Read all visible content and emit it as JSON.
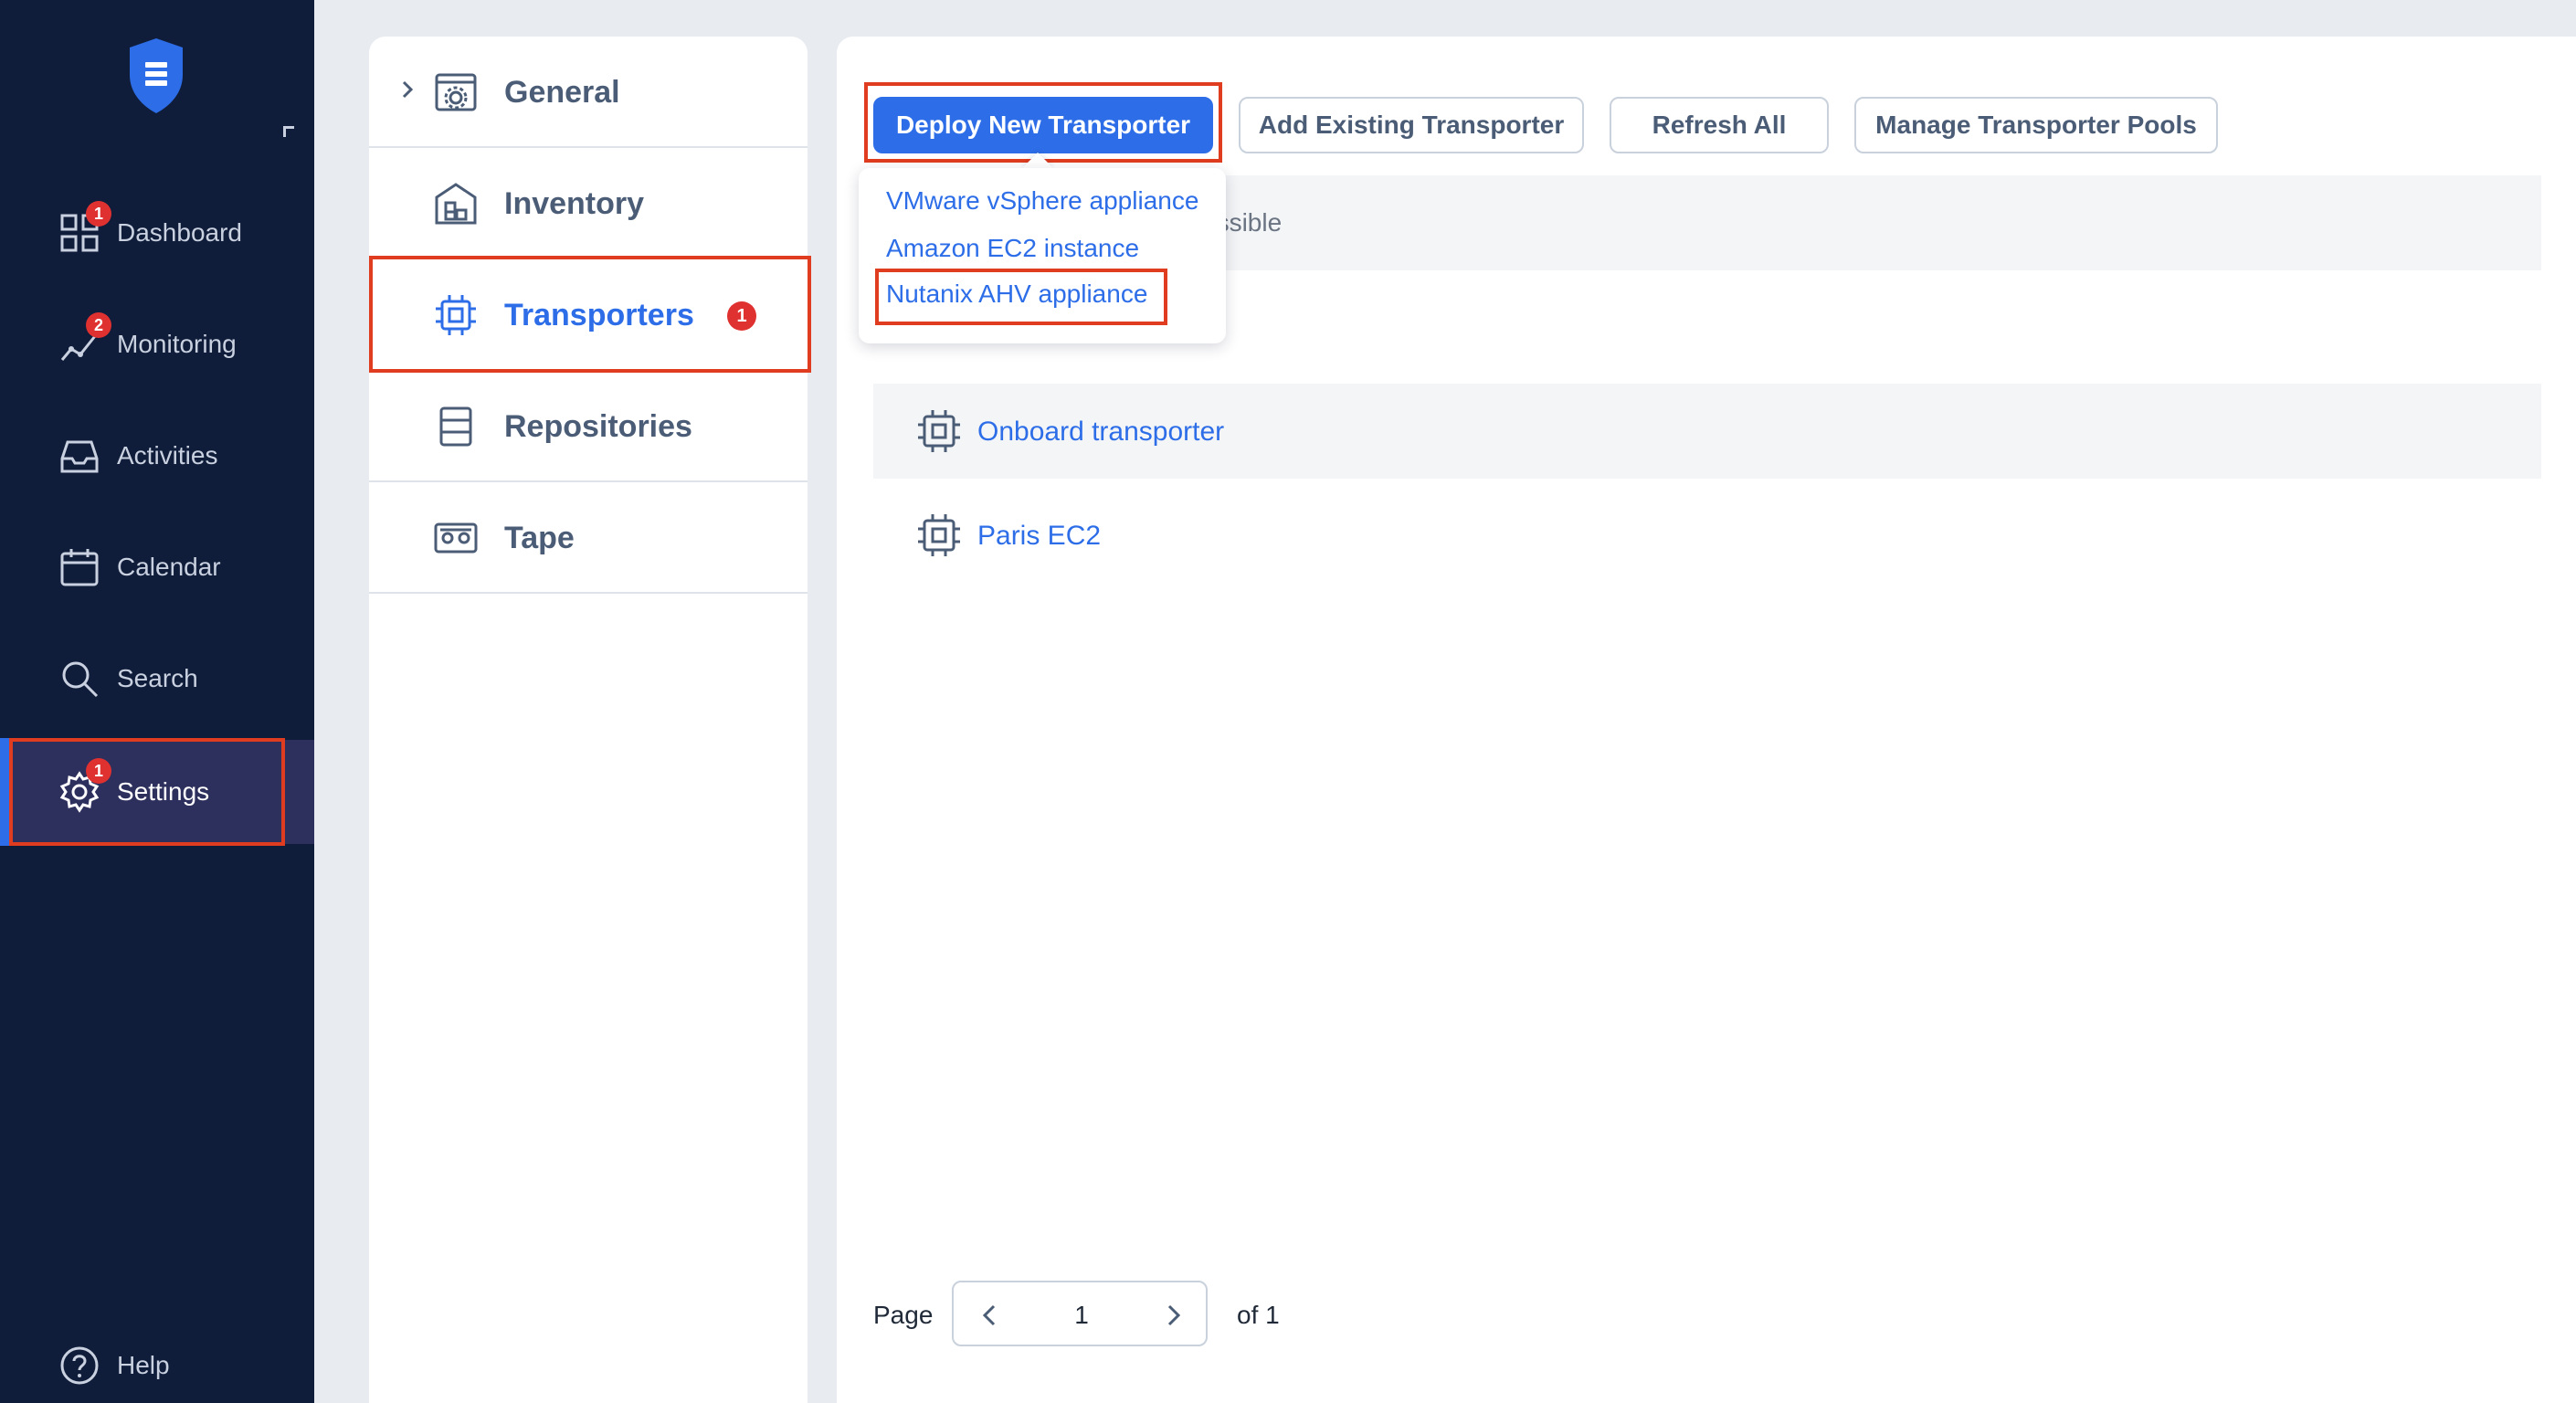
{
  "sidebar": {
    "items": [
      {
        "label": "Dashboard",
        "badge": "1",
        "icon": "grid-icon"
      },
      {
        "label": "Monitoring",
        "badge": "2",
        "icon": "chart-line-icon"
      },
      {
        "label": "Activities",
        "badge": "",
        "icon": "inbox-icon"
      },
      {
        "label": "Calendar",
        "badge": "",
        "icon": "calendar-icon"
      },
      {
        "label": "Search",
        "badge": "",
        "icon": "search-icon"
      },
      {
        "label": "Settings",
        "badge": "1",
        "icon": "gear-icon"
      }
    ],
    "help_label": "Help"
  },
  "sections": {
    "items": [
      {
        "label": "General",
        "icon": "general-settings-icon"
      },
      {
        "label": "Inventory",
        "icon": "inventory-icon"
      },
      {
        "label": "Transporters",
        "icon": "chip-icon",
        "badge": "1"
      },
      {
        "label": "Repositories",
        "icon": "repository-icon"
      },
      {
        "label": "Tape",
        "icon": "tape-icon"
      }
    ]
  },
  "toolbar": {
    "deploy_label": "Deploy New Transporter",
    "add_label": "Add Existing Transporter",
    "refresh_label": "Refresh All",
    "pools_label": "Manage Transporter Pools"
  },
  "deploy_menu": {
    "items": [
      "VMware vSphere appliance",
      "Amazon EC2 instance",
      "Nutanix AHV appliance"
    ]
  },
  "transporters": {
    "partial_text": "essible",
    "rows": [
      "Onboard transporter",
      "Paris EC2"
    ]
  },
  "pagination": {
    "page_label": "Page",
    "current_page": "1",
    "of_label": "of 1"
  },
  "colors": {
    "sidebar_bg": "#0f1d3a",
    "accent": "#2d6ee8",
    "badge": "#e03131",
    "highlight": "#e03c1f"
  }
}
